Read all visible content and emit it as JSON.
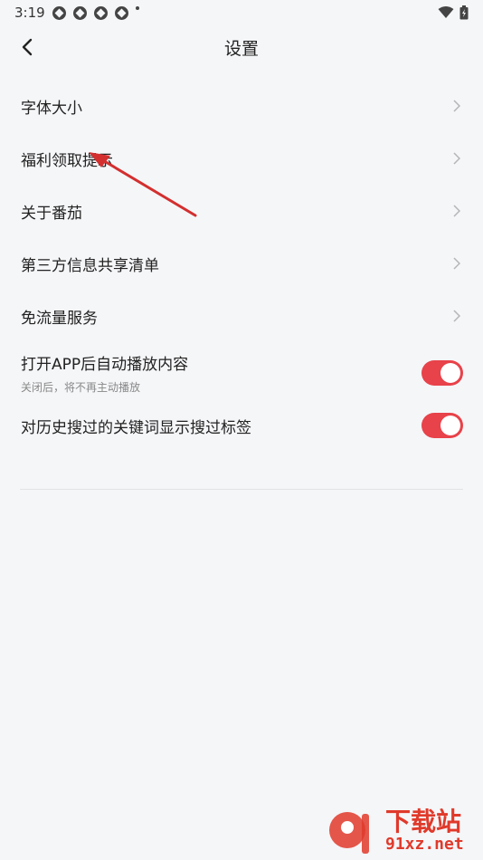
{
  "status_bar": {
    "time": "3:19"
  },
  "header": {
    "title": "设置"
  },
  "settings": {
    "items": [
      {
        "label": "字体大小"
      },
      {
        "label": "福利领取提示"
      },
      {
        "label": "关于番茄"
      },
      {
        "label": "第三方信息共享清单"
      },
      {
        "label": "免流量服务"
      }
    ],
    "toggles": [
      {
        "label": "打开APP后自动播放内容",
        "sublabel": "关闭后，将不再主动播放",
        "on": true
      },
      {
        "label": "对历史搜过的关键词显示搜过标签",
        "on": true
      }
    ]
  },
  "watermark": {
    "title": "下载站",
    "url": "91xz.net"
  },
  "colors": {
    "accent": "#e8424a",
    "annotation_arrow": "#d32f2f"
  }
}
